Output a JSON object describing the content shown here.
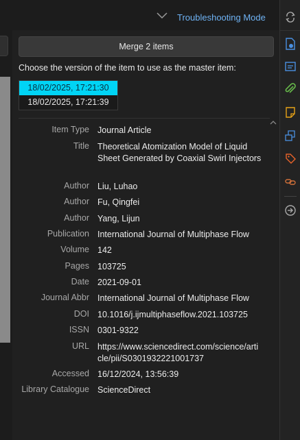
{
  "header": {
    "mode_label": "Troubleshooting Mode",
    "mode_color": "#6fb3f5"
  },
  "merge": {
    "button_label": "Merge 2 items",
    "choose_text": "Choose the version of the item to use as the master item:"
  },
  "versions": [
    {
      "label": "18/02/2025, 17:21:30",
      "selected": true
    },
    {
      "label": "18/02/2025, 17:21:39",
      "selected": false
    }
  ],
  "fields": {
    "item_type": {
      "label": "Item Type",
      "value": "Journal Article"
    },
    "title": {
      "label": "Title",
      "value": "Theoretical Atomization Model of Liquid Sheet Generated by Coaxial Swirl Injectors"
    },
    "author1": {
      "label": "Author",
      "value": "Liu, Luhao"
    },
    "author2": {
      "label": "Author",
      "value": "Fu, Qingfei"
    },
    "author3": {
      "label": "Author",
      "value": "Yang, Lijun"
    },
    "publication": {
      "label": "Publication",
      "value": "International Journal of Multiphase Flow"
    },
    "volume": {
      "label": "Volume",
      "value": "142"
    },
    "pages": {
      "label": "Pages",
      "value": "103725"
    },
    "date": {
      "label": "Date",
      "value": "2021-09-01"
    },
    "journal_abbr": {
      "label": "Journal Abbr",
      "value": "International Journal of Multiphase Flow"
    },
    "doi": {
      "label": "DOI",
      "value": "10.1016/j.ijmultiphaseflow.2021.103725"
    },
    "issn": {
      "label": "ISSN",
      "value": "0301-9322"
    },
    "url": {
      "label": "URL",
      "value": "https://www.sciencedirect.com/science/article/pii/S0301932221001737"
    },
    "accessed": {
      "label": "Accessed",
      "value": "16/12/2024, 13:56:39"
    },
    "library_catalogue": {
      "label": "Library Catalogue",
      "value": "ScienceDirect"
    }
  },
  "sidebar_icons": [
    "sync-icon",
    "info-icon",
    "abstract-icon",
    "attachments-icon",
    "notes-icon",
    "libraries-collections-icon",
    "tags-icon",
    "related-icon",
    "locate-icon"
  ],
  "colors": {
    "selection": "#00d4f5",
    "accent": "#6fb3f5"
  }
}
